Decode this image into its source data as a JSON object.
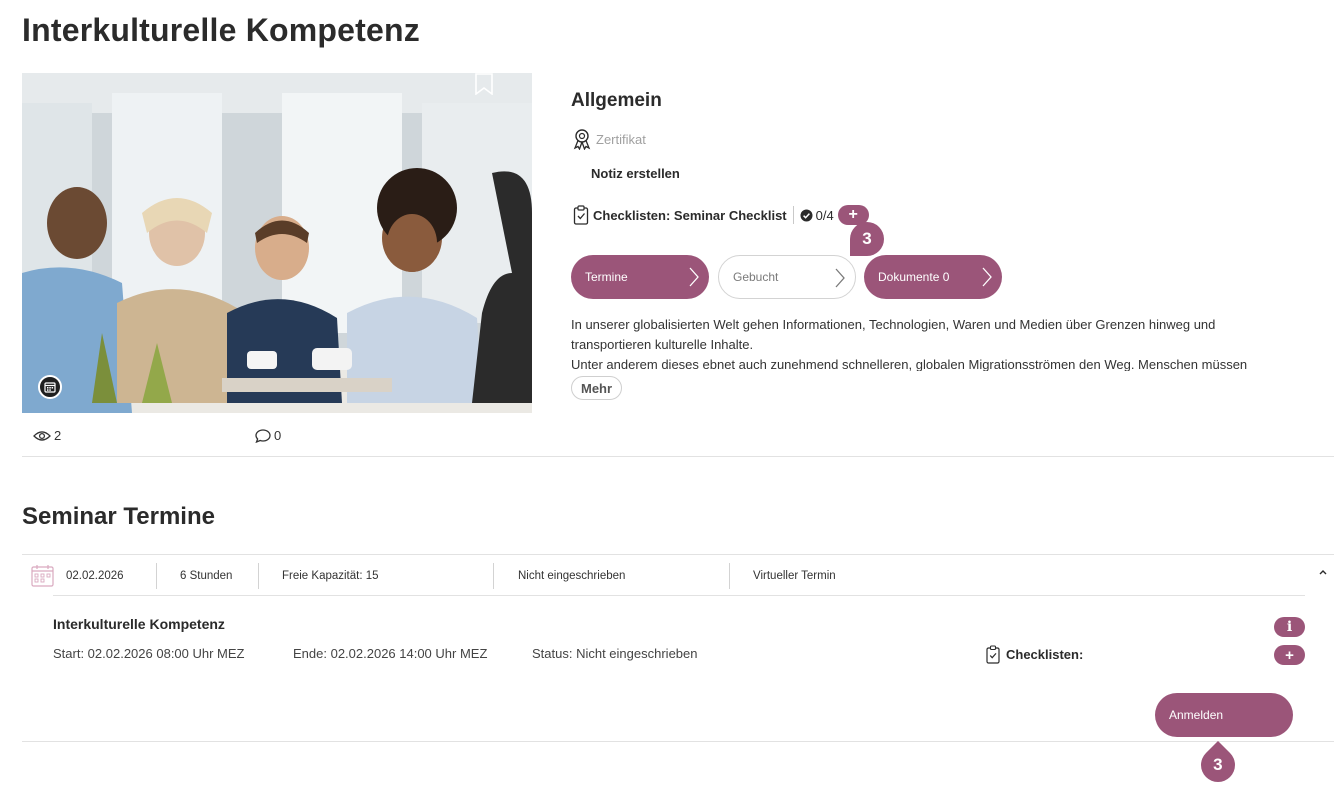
{
  "page_title": "Interkulturelle Kompetenz",
  "stats": {
    "views": "2",
    "comments": "0"
  },
  "general": {
    "heading": "Allgemein",
    "certificate": "Zertifikat",
    "note": "Notiz erstellen",
    "checklist_label": "Checklisten: Seminar Checklist",
    "checklist_count": "0/4",
    "add": "+"
  },
  "tabs": [
    {
      "label": "Termine"
    },
    {
      "label": "Gebucht"
    },
    {
      "label": "Dokumente 0"
    }
  ],
  "description": {
    "line1": "In unserer globalisierten Welt gehen Informationen, Technologien, Waren und Medien über Grenzen hinweg und",
    "line2": "transportieren kulturelle Inhalte.",
    "line3": "Unter anderem dieses ebnet auch zunehmend schnelleren, globalen Migrationsströmen den Weg. Menschen müssen",
    "more": "Mehr"
  },
  "step_badges": {
    "a": "3",
    "b": "3"
  },
  "seminar": {
    "heading": "Seminar Termine",
    "row": {
      "date": "02.02.2026",
      "duration": "6 Stunden",
      "capacity": "Freie Kapazität: 15",
      "status": "Nicht eingeschrieben",
      "type": "Virtueller Termin"
    },
    "detail": {
      "title": "Interkulturelle Kompetenz",
      "start": "Start: 02.02.2026 08:00 Uhr MEZ",
      "end": "Ende: 02.02.2026 14:00 Uhr MEZ",
      "status": "Status: Nicht eingeschrieben",
      "checklists": "Checklisten:",
      "info": "i",
      "add": "+",
      "register": "Anmelden"
    }
  },
  "colors": {
    "accent": "#9b5579",
    "text": "#2b2b2b",
    "muted": "#a0a0a0",
    "divider": "#e2e2e2"
  }
}
